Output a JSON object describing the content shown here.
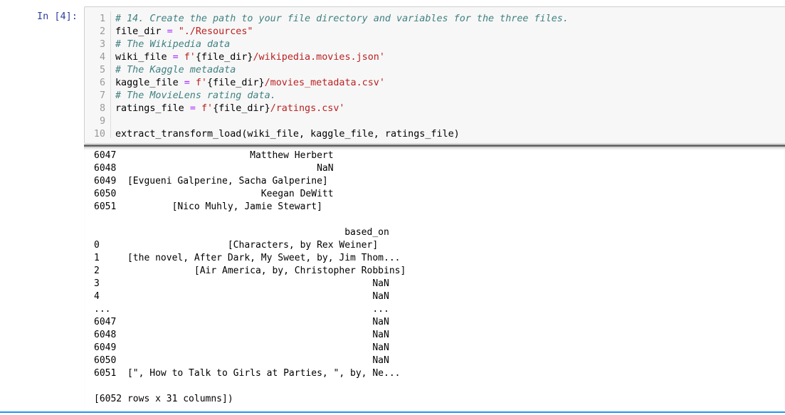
{
  "cell": {
    "prompt": "In [4]:",
    "code_lines": [
      {
        "num": "1",
        "parts": [
          {
            "t": "# 14. Create the path to your file directory and variables for the three files.",
            "c": "cm"
          }
        ]
      },
      {
        "num": "2",
        "parts": [
          {
            "t": "file_dir ",
            "c": ""
          },
          {
            "t": "=",
            "c": "op"
          },
          {
            "t": " ",
            "c": ""
          },
          {
            "t": "\"./Resources\"",
            "c": "str"
          }
        ]
      },
      {
        "num": "3",
        "parts": [
          {
            "t": "# The Wikipedia data",
            "c": "cm"
          }
        ]
      },
      {
        "num": "4",
        "parts": [
          {
            "t": "wiki_file ",
            "c": ""
          },
          {
            "t": "=",
            "c": "op"
          },
          {
            "t": " ",
            "c": ""
          },
          {
            "t": "f'",
            "c": "str"
          },
          {
            "t": "{file_dir}",
            "c": ""
          },
          {
            "t": "/wikipedia.movies.json'",
            "c": "str"
          }
        ]
      },
      {
        "num": "5",
        "parts": [
          {
            "t": "# The Kaggle metadata",
            "c": "cm"
          }
        ]
      },
      {
        "num": "6",
        "parts": [
          {
            "t": "kaggle_file ",
            "c": ""
          },
          {
            "t": "=",
            "c": "op"
          },
          {
            "t": " ",
            "c": ""
          },
          {
            "t": "f'",
            "c": "str"
          },
          {
            "t": "{file_dir}",
            "c": ""
          },
          {
            "t": "/movies_metadata.csv'",
            "c": "str"
          }
        ]
      },
      {
        "num": "7",
        "parts": [
          {
            "t": "# The MovieLens rating data.",
            "c": "cm"
          }
        ]
      },
      {
        "num": "8",
        "parts": [
          {
            "t": "ratings_file ",
            "c": ""
          },
          {
            "t": "=",
            "c": "op"
          },
          {
            "t": " ",
            "c": ""
          },
          {
            "t": "f'",
            "c": "str"
          },
          {
            "t": "{file_dir}",
            "c": ""
          },
          {
            "t": "/ratings.csv'",
            "c": "str"
          }
        ]
      },
      {
        "num": "9",
        "parts": []
      },
      {
        "num": "10",
        "parts": [
          {
            "t": "extract_transform_load(wiki_file, kaggle_file, ratings_file)",
            "c": ""
          }
        ]
      }
    ]
  },
  "output": {
    "lines": [
      "6047                        Matthew Herbert",
      "6048                                    NaN",
      "6049  [Evgueni Galperine, Sacha Galperine]",
      "6050                          Keegan DeWitt",
      "6051          [Nico Muhly, Jamie Stewart]",
      "",
      "                                             based_on",
      "0                       [Characters, by Rex Weiner]",
      "1     [the novel, After Dark, My Sweet, by, Jim Thom...",
      "2                 [Air America, by, Christopher Robbins]",
      "3                                                 NaN",
      "4                                                 NaN",
      "...                                               ...",
      "6047                                              NaN",
      "6048                                              NaN",
      "6049                                              NaN",
      "6050                                              NaN",
      "6051  [\", How to Talk to Girls at Parties, \", by, Ne...",
      "",
      "[6052 rows x 31 columns])"
    ]
  }
}
